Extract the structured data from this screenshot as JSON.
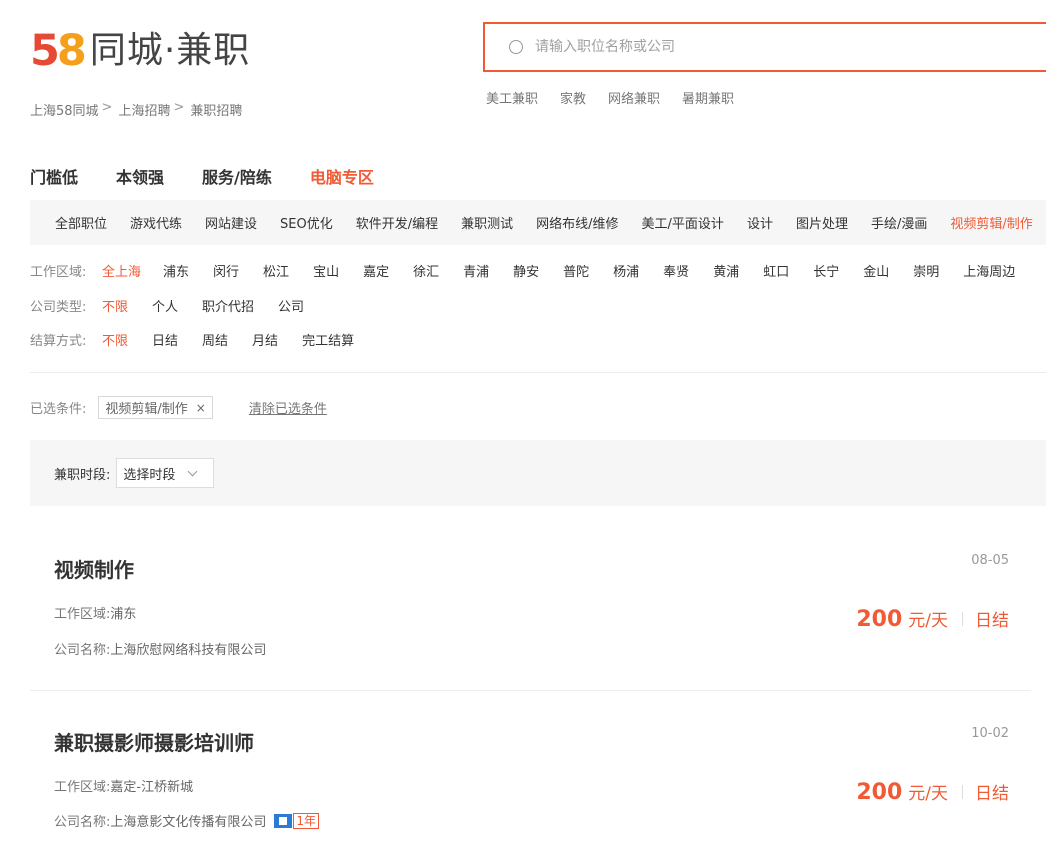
{
  "logo": {
    "num5": "5",
    "num8": "8",
    "text": "同城·兼职"
  },
  "search": {
    "placeholder": "请输入职位名称或公司",
    "value": ""
  },
  "hotwords": [
    "美工兼职",
    "家教",
    "网络兼职",
    "暑期兼职"
  ],
  "breadcrumb": [
    "上海58同城",
    "上海招聘",
    "兼职招聘"
  ],
  "breadcrumb_sep": ">",
  "category_tabs": [
    "门槛低",
    "本领强",
    "服务/陪练",
    "电脑专区"
  ],
  "subcategories": [
    "全部职位",
    "游戏代练",
    "网站建设",
    "SEO优化",
    "软件开发/编程",
    "兼职测试",
    "网络布线/维修",
    "美工/平面设计",
    "设计",
    "图片处理",
    "手绘/漫画",
    "视频剪辑/制作"
  ],
  "filters": {
    "area": {
      "label": "工作区域:",
      "options": [
        "全上海",
        "浦东",
        "闵行",
        "松江",
        "宝山",
        "嘉定",
        "徐汇",
        "青浦",
        "静安",
        "普陀",
        "杨浦",
        "奉贤",
        "黄浦",
        "虹口",
        "长宁",
        "金山",
        "崇明",
        "上海周边"
      ]
    },
    "company_type": {
      "label": "公司类型:",
      "options": [
        "不限",
        "个人",
        "职介代招",
        "公司"
      ]
    },
    "settlement": {
      "label": "结算方式:",
      "options": [
        "不限",
        "日结",
        "周结",
        "月结",
        "完工结算"
      ]
    }
  },
  "selected": {
    "label": "已选条件:",
    "tag": "视频剪辑/制作",
    "remove": "×",
    "clear": "清除已选条件"
  },
  "timebar": {
    "label": "兼职时段:",
    "select": "选择时段"
  },
  "jobs": [
    {
      "title": "视频制作",
      "date": "08-05",
      "area_label": "工作区域:",
      "area": "浦东",
      "company_label": "公司名称:",
      "company": "上海欣慰网络科技有限公司",
      "pay": "200",
      "unit": "元/天",
      "settle": "日结"
    },
    {
      "title": "兼职摄影师摄影培训师",
      "date": "10-02",
      "area_label": "工作区域:",
      "area": "嘉定-江桥新城",
      "company_label": "公司名称:",
      "company": "上海意影文化传播有限公司",
      "badge": "1年",
      "pay": "200",
      "unit": "元/天",
      "settle": "日结"
    }
  ],
  "colors": {
    "accent": "#f05a35",
    "logo5": "#e64a35",
    "logo8": "#f5a01d",
    "badge_blue": "#2b7ad8"
  }
}
